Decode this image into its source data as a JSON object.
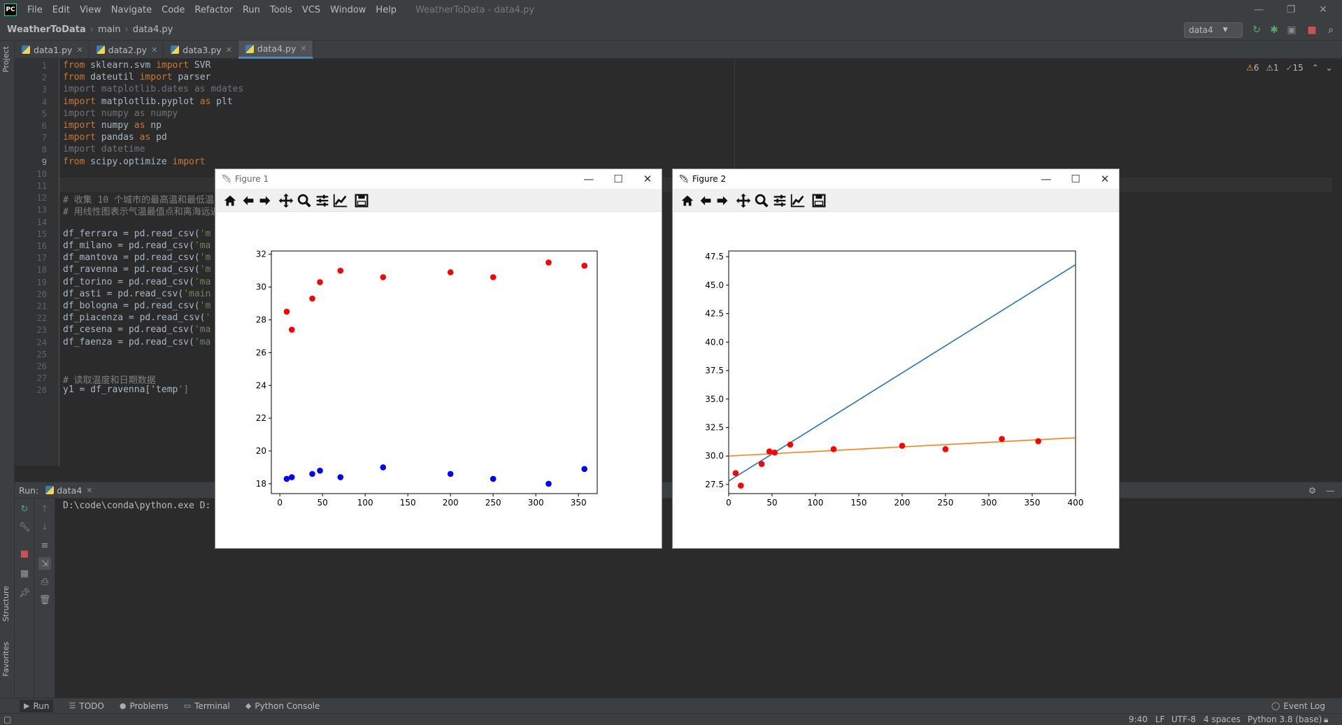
{
  "app": {
    "logo_text": "PC",
    "menu": [
      "File",
      "Edit",
      "View",
      "Navigate",
      "Code",
      "Refactor",
      "Run",
      "Tools",
      "VCS",
      "Window",
      "Help"
    ],
    "window_title": "WeatherToData - data4.py",
    "run_config": "data4"
  },
  "breadcrumb": [
    "WeatherToData",
    "main",
    "data4.py"
  ],
  "tabs": [
    "data1.py",
    "data2.py",
    "data3.py",
    "data4.py"
  ],
  "sidebar_labels": {
    "project": "Project",
    "structure": "Structure",
    "favorites": "Favorites"
  },
  "inspections": {
    "warnings": "6",
    "weak": "1",
    "ok": "15"
  },
  "editor": {
    "line_numbers": [
      "1",
      "2",
      "3",
      "4",
      "5",
      "6",
      "7",
      "8",
      "9",
      "10",
      "11",
      "12",
      "13",
      "14",
      "15",
      "16",
      "17",
      "18",
      "19",
      "20",
      "21",
      "22",
      "23",
      "24",
      "25",
      "26",
      "27",
      "28"
    ],
    "lines": [
      "from sklearn.svm import SVR",
      "from dateutil import parser",
      "import matplotlib.dates as mdates",
      "import matplotlib.pyplot as plt",
      "import numpy as numpy",
      "import numpy as np",
      "import pandas as pd",
      "import datetime",
      "from scipy.optimize import",
      "",
      "",
      "# 收集 10 个城市的最高温和最低温",
      "# 用线性图表示气温最值点和离海远近",
      "",
      "df_ferrara = pd.read_csv('m",
      "df_milano = pd.read_csv('ma",
      "df_mantova = pd.read_csv('m",
      "df_ravenna = pd.read_csv('m",
      "df_torino = pd.read_csv('ma",
      "df_asti = pd.read_csv('main",
      "df_bologna = pd.read_csv('m",
      "df_piacenza = pd.read_csv('",
      "df_cesena = pd.read_csv('ma",
      "df_faenza = pd.read_csv('ma",
      "",
      "",
      "# 读取温度和日期数据",
      "y1 = df_ravenna['temp']"
    ]
  },
  "run": {
    "label": "Run:",
    "tab": "data4",
    "console_line": "D:\\code\\conda\\python.exe D:"
  },
  "bottom_tabs": [
    "Run",
    "TODO",
    "Problems",
    "Terminal",
    "Python Console"
  ],
  "event_log": "Event Log",
  "status": {
    "position": "9:40",
    "line_sep": "LF",
    "encoding": "UTF-8",
    "indent": "4 spaces",
    "interpreter": "Python 3.8 (base)"
  },
  "figures": [
    {
      "title": "Figure 1",
      "chart_data": {
        "type": "scatter",
        "xlim": [
          -10,
          372
        ],
        "ylim": [
          17.4,
          32.2
        ],
        "xticks": [
          0,
          50,
          100,
          150,
          200,
          250,
          300,
          350
        ],
        "yticks": [
          18,
          20,
          22,
          24,
          26,
          28,
          30,
          32
        ],
        "series": [
          {
            "color": "#ff0000",
            "x": [
              8,
              14,
              38,
              47,
              71,
              121,
              200,
              250,
              315,
              357
            ],
            "y": [
              28.5,
              27.4,
              29.3,
              30.3,
              31.0,
              30.6,
              30.9,
              30.6,
              31.5,
              31.3
            ]
          },
          {
            "color": "#0000ff",
            "x": [
              8,
              14,
              38,
              47,
              71,
              121,
              200,
              250,
              315,
              357
            ],
            "y": [
              18.3,
              18.4,
              18.6,
              18.8,
              18.4,
              19.0,
              18.6,
              18.3,
              18.0,
              18.9
            ]
          }
        ]
      }
    },
    {
      "title": "Figure 2",
      "chart_data": {
        "type": "scatter",
        "xlim": [
          0,
          400
        ],
        "ylim": [
          26.7,
          48.0
        ],
        "xticks": [
          0,
          50,
          100,
          150,
          200,
          250,
          300,
          350,
          400
        ],
        "yticks": [
          27.5,
          30.0,
          32.5,
          35.0,
          37.5,
          40.0,
          42.5,
          45.0,
          47.5
        ],
        "yticklabels": [
          "27.5",
          "30.0",
          "32.5",
          "35.0",
          "37.5",
          "40.0",
          "42.5",
          "45.0",
          "47.5"
        ],
        "series": [
          {
            "color": "#ff0000",
            "x": [
              8,
              14,
              38,
              47,
              53,
              71,
              121,
              200,
              250,
              315,
              357
            ],
            "y": [
              28.5,
              27.4,
              29.3,
              30.4,
              30.3,
              31.0,
              30.6,
              30.9,
              30.6,
              31.5,
              31.3
            ]
          }
        ],
        "lines": [
          {
            "color": "#1f77b4",
            "x": [
              0,
              400
            ],
            "y": [
              27.8,
              46.8
            ]
          },
          {
            "color": "#ff7f0e",
            "x": [
              0,
              400
            ],
            "y": [
              30.0,
              31.6
            ]
          }
        ]
      }
    }
  ]
}
